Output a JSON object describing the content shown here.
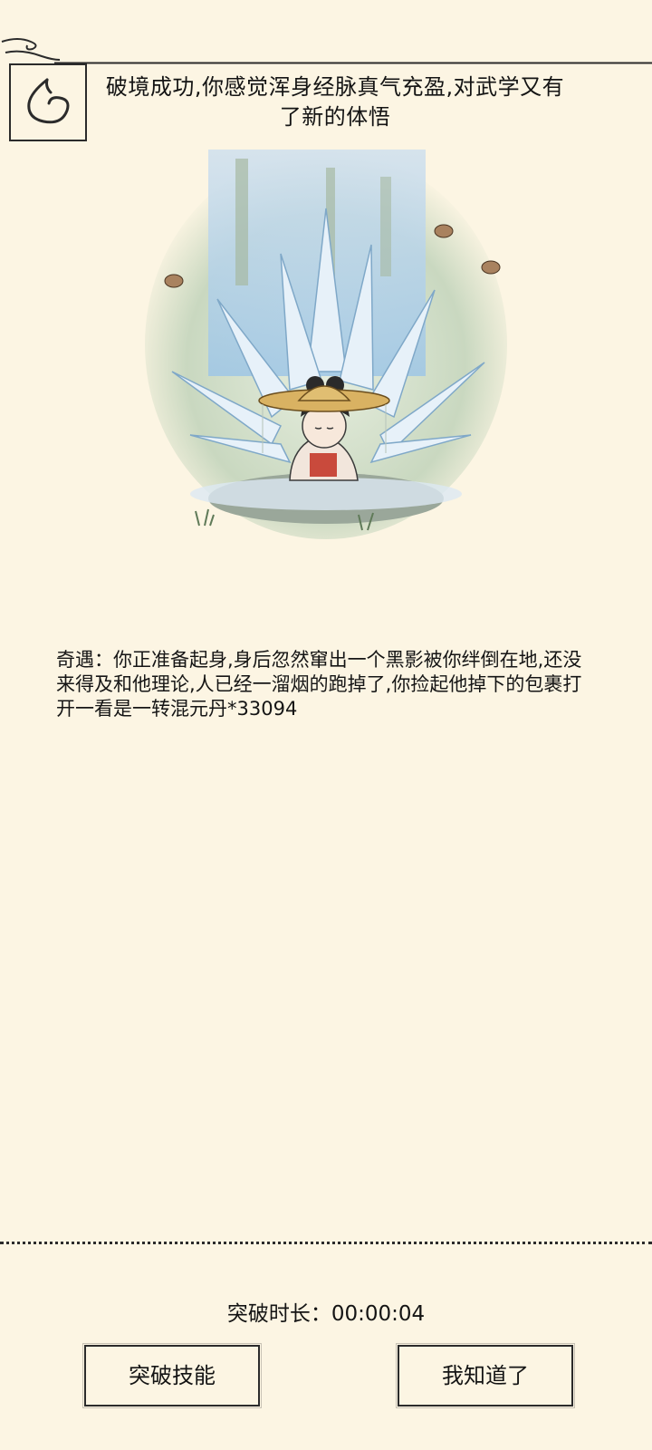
{
  "header": {
    "back_icon": "back-swirl-icon",
    "title": "破境成功,你感觉浑身经脉真气充盈,对武学又有了新的体悟"
  },
  "illustration": {
    "subject": "meditating-figure-waterfall-icon"
  },
  "event": {
    "text": "奇遇：你正准备起身,身后忽然窜出一个黑影被你绊倒在地,还没来得及和他理论,人已经一溜烟的跑掉了,你捡起他掉下的包裹打开一看是一转混元丹*33094"
  },
  "footer": {
    "duration_label": "突破时长：",
    "duration_value": "00:00:04",
    "left_button": "突破技能",
    "right_button": "我知道了"
  },
  "colors": {
    "background": "#fcf5e3",
    "ink": "#2b2b2b",
    "water": "#9ec6e6",
    "mist": "#b8cdb0"
  }
}
